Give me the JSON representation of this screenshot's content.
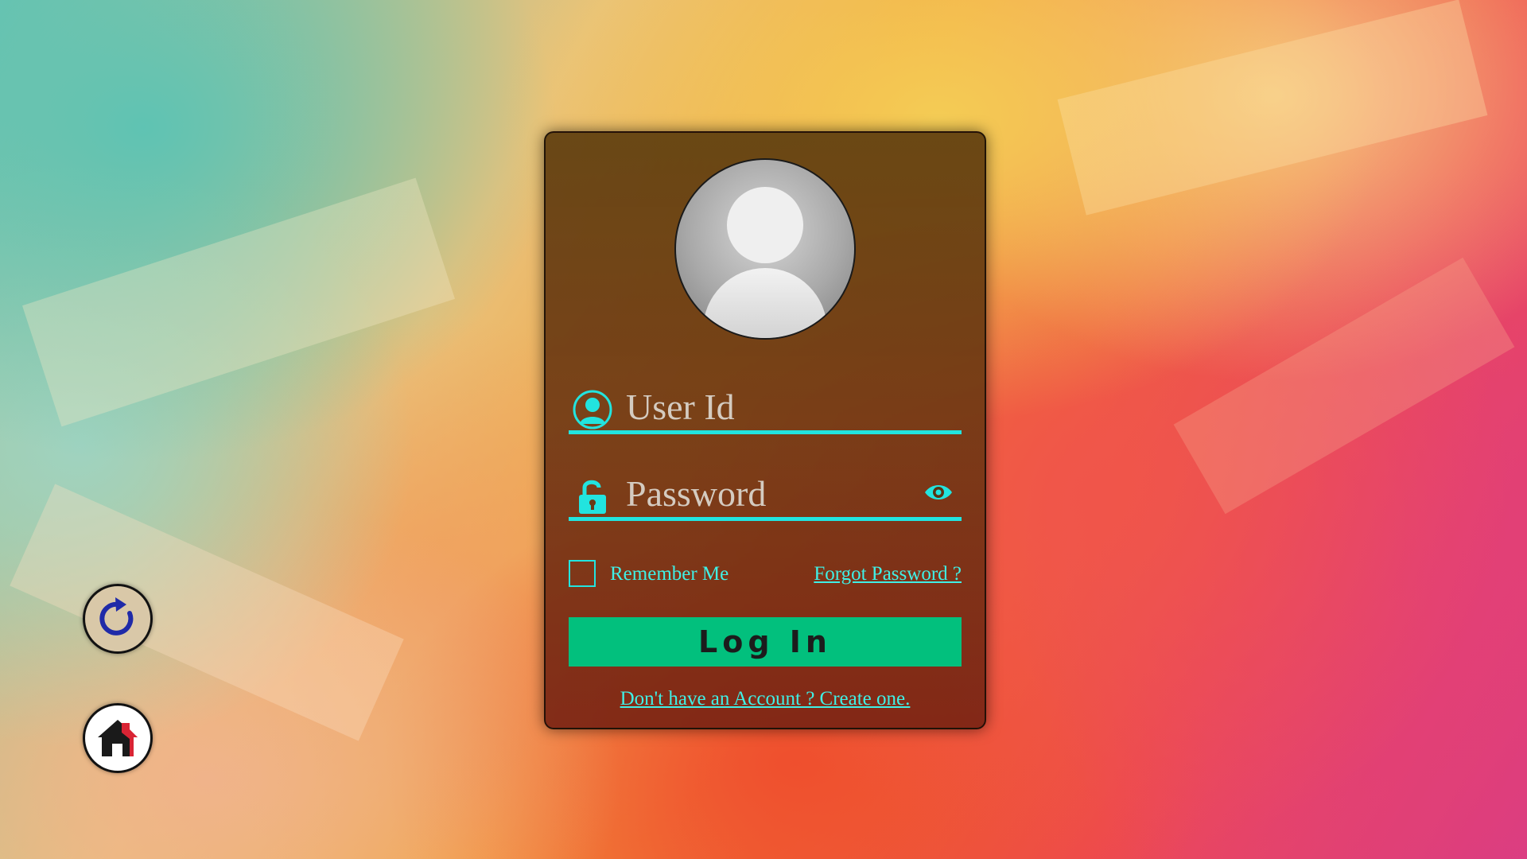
{
  "login_form": {
    "user_placeholder": "User Id",
    "password_placeholder": "Password",
    "remember_label": "Remember Me",
    "forgot_link": "Forgot Password ?",
    "login_button": "Log In",
    "create_link": "Don't have an Account ? Create one."
  },
  "icons": {
    "avatar": "user-avatar-icon",
    "user_field": "user-icon",
    "password_field": "unlock-icon",
    "show_password": "eye-icon",
    "refresh": "refresh-icon",
    "home": "home-icon"
  },
  "colors": {
    "accent": "#22e4df",
    "link": "#3ff0e6",
    "login_button": "#02c07d",
    "refresh_arrow": "#1f2aa8",
    "home_roof": "#d92434"
  }
}
